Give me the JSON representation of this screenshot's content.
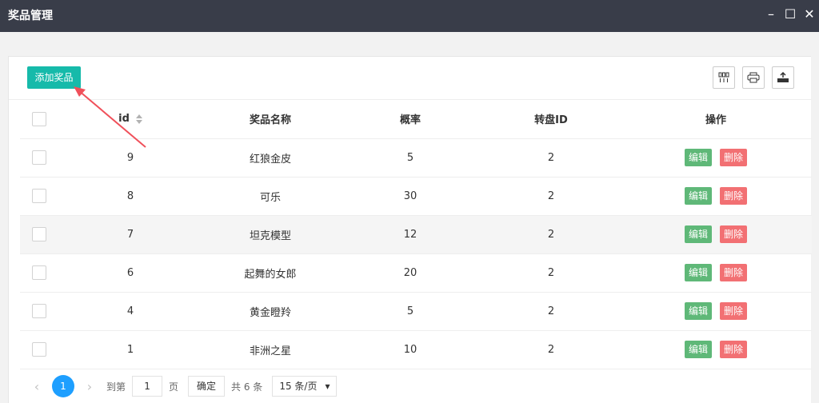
{
  "window": {
    "title": "奖品管理",
    "minimize_icon": "minimize-icon",
    "maximize_icon": "maximize-icon",
    "close_icon": "close-icon"
  },
  "toolbar": {
    "add_label": "添加奖品",
    "icons": [
      "columns-icon",
      "print-icon",
      "export-icon"
    ]
  },
  "table": {
    "headers": {
      "id": "id",
      "name": "奖品名称",
      "prob": "概率",
      "wheel": "转盘ID",
      "ops": "操作"
    },
    "rows": [
      {
        "id": "9",
        "name": "红狼金皮",
        "prob": "5",
        "wheel": "2"
      },
      {
        "id": "8",
        "name": "可乐",
        "prob": "30",
        "wheel": "2"
      },
      {
        "id": "7",
        "name": "坦克模型",
        "prob": "12",
        "wheel": "2"
      },
      {
        "id": "6",
        "name": "起舞的女郎",
        "prob": "20",
        "wheel": "2"
      },
      {
        "id": "4",
        "name": "黄金瞪羚",
        "prob": "5",
        "wheel": "2"
      },
      {
        "id": "1",
        "name": "非洲之星",
        "prob": "10",
        "wheel": "2"
      }
    ],
    "edit_label": "编辑",
    "delete_label": "删除"
  },
  "pager": {
    "current": "1",
    "goto_label": "到第",
    "goto_value": "1",
    "page_label": "页",
    "confirm_label": "确定",
    "total_label": "共 6 条",
    "page_size": "15 条/页"
  },
  "colors": {
    "titlebar": "#393d49",
    "add_button": "#16baaa",
    "edit": "#5fb878",
    "delete": "#f27073",
    "page_current": "#1e9fff",
    "annotation_arrow": "#f0505a"
  }
}
